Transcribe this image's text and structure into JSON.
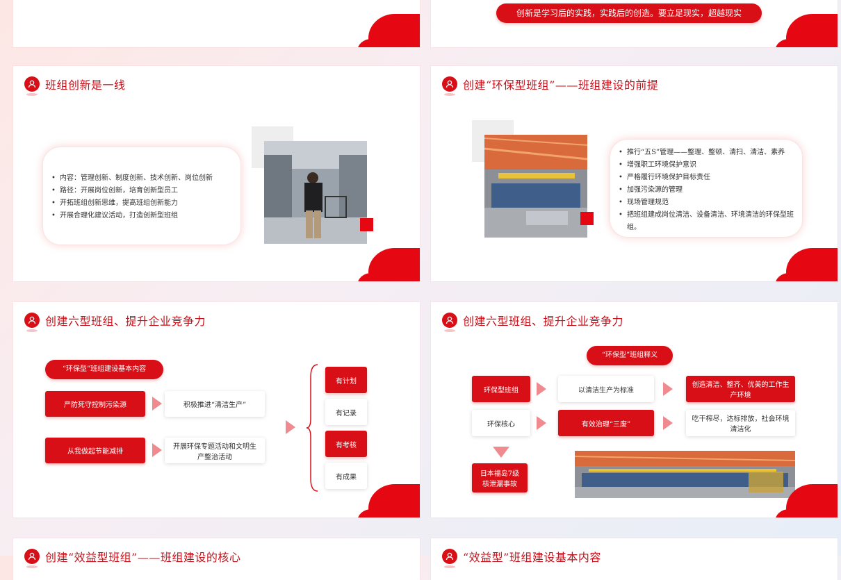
{
  "slides": {
    "s2": {
      "quote": "创新是学习后的实践，实践后的创造。要立足现实，超越现实"
    },
    "s3": {
      "title": "班组创新是一线",
      "bullets": [
        "内容：管理创新、制度创新、技术创新、岗位创新",
        "路径：开展岗位创新，培育创新型员工",
        "开拓班组创新思维，提高班组创新能力",
        "开展合理化建议活动，打造创新型班组"
      ]
    },
    "s4": {
      "title": "创建“环保型班组”——班组建设的前提",
      "bullets": [
        "推行“五S”管理——整理、整顿、清扫、清洁、素养",
        "增强职工环境保护意识",
        "严格履行环境保护目标责任",
        "加强污染源的管理",
        "现场管理规范",
        "把班组建成岗位清洁、设备清洁、环境清洁的环保型班组。"
      ]
    },
    "s5": {
      "title": "创建六型班组、提升企业竞争力",
      "pill": "“环保型”班组建设基本内容",
      "row1_left": "严防死守控制污染源",
      "row1_right": "积极推进“清洁生产”",
      "row2_left": "从我做起节能减排",
      "row2_right": "开展环保专题活动和文明生产整治活动",
      "list": [
        "有计划",
        "有记录",
        "有考核",
        "有成果"
      ]
    },
    "s6": {
      "title": "创建六型班组、提升企业竞争力",
      "pill": "“环保型”班组释义",
      "r1c1": "环保型班组",
      "r1c2": "以清洁生产为标准",
      "r1c3": "创造清洁、整齐、优美的工作生产环境",
      "r2c1": "环保核心",
      "r2c2": "有效治理“三废”",
      "r2c3": "吃干榨尽，达标排放，社会环境清洁化",
      "note": "日本福岛7级核泄漏事故"
    },
    "s7": {
      "title": "创建“效益型班组”——班组建设的核心"
    },
    "s8": {
      "title": "“效益型”班组建设基本内容"
    }
  },
  "icons": {
    "badge": "user-group-icon"
  },
  "colors": {
    "accent": "#d90f18",
    "title": "#c8101a"
  }
}
